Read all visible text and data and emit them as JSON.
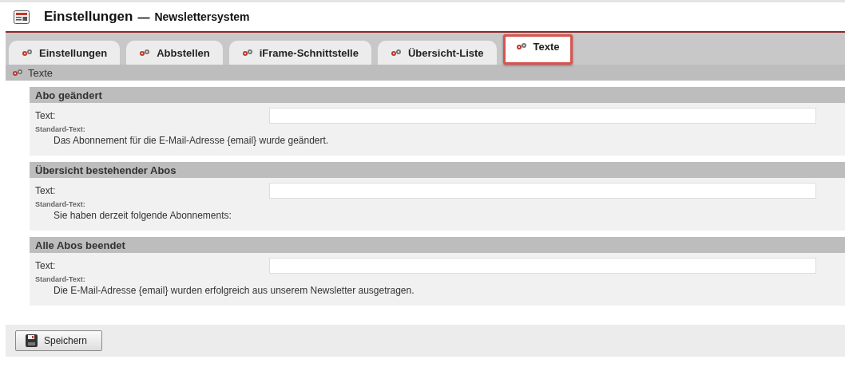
{
  "header": {
    "title": "Einstellungen",
    "subtitle": "Newslettersystem",
    "separator": "—"
  },
  "tabs": [
    {
      "label": "Einstellungen",
      "selected": false
    },
    {
      "label": "Abbstellen",
      "selected": false
    },
    {
      "label": "iFrame-Schnittstelle",
      "selected": false
    },
    {
      "label": "Übersicht-Liste",
      "selected": false
    },
    {
      "label": "Texte",
      "selected": true
    }
  ],
  "section_title": "Texte",
  "groups": [
    {
      "title": "Abo geändert",
      "field_label": "Text:",
      "default_label": "Standard-Text:",
      "default_text": "Das Abonnement für die E-Mail-Adresse {email} wurde geändert."
    },
    {
      "title": "Übersicht bestehender Abos",
      "field_label": "Text:",
      "default_label": "Standard-Text:",
      "default_text": "Sie haben derzeit folgende Abonnements:"
    },
    {
      "title": "Alle Abos beendet",
      "field_label": "Text:",
      "default_label": "Standard-Text:",
      "default_text": "Die E-Mail-Adresse {email} wurden erfolgreich aus unserem Newsletter ausgetragen."
    }
  ],
  "save_button": "Speichern"
}
